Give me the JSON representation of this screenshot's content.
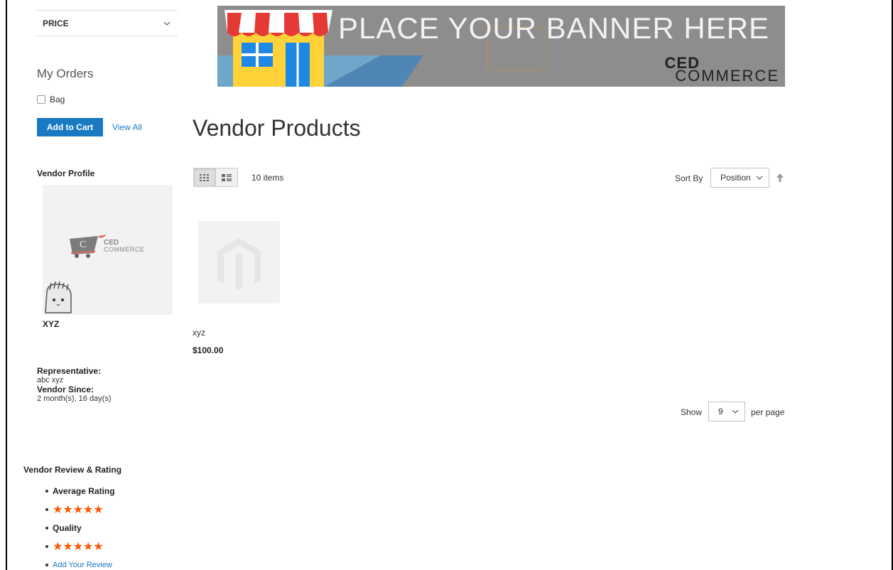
{
  "sidebar": {
    "filter_label": "PRICE",
    "my_orders": {
      "title": "My Orders",
      "item_label": "Bag",
      "add_to_cart": "Add to Cart",
      "view_all": "View All"
    },
    "vendor_profile": {
      "title": "Vendor Profile",
      "logo_text_1": "CED",
      "logo_text_2": "COMMERCE",
      "name": "XYZ",
      "representative_label": "Representative:",
      "representative_value": "abc xyz",
      "since_label": "Vendor Since:",
      "since_value": "2 month(s), 16 day(s)"
    },
    "reviews": {
      "title": "Vendor Review & Rating",
      "items": [
        {
          "label": "Average Rating",
          "stars": "★★★★★"
        },
        {
          "label": "Quality",
          "stars": "★★★★★"
        }
      ],
      "add_review": "Add Your Review"
    }
  },
  "banner": {
    "text": "PLACE YOUR BANNER HERE",
    "logo_line1": "CED",
    "logo_line2": "COMMERCE"
  },
  "main": {
    "title": "Vendor Products",
    "item_count": "10 items",
    "sort_label": "Sort By",
    "sort_value": "Position",
    "products": [
      {
        "name": "xyz",
        "price": "$100.00"
      }
    ],
    "show_label": "Show",
    "limit_value": "9",
    "per_page_label": "per page"
  },
  "colors": {
    "accent": "#1979c3",
    "star": "#ff5501",
    "banner_bg": "#8f8f8f"
  }
}
